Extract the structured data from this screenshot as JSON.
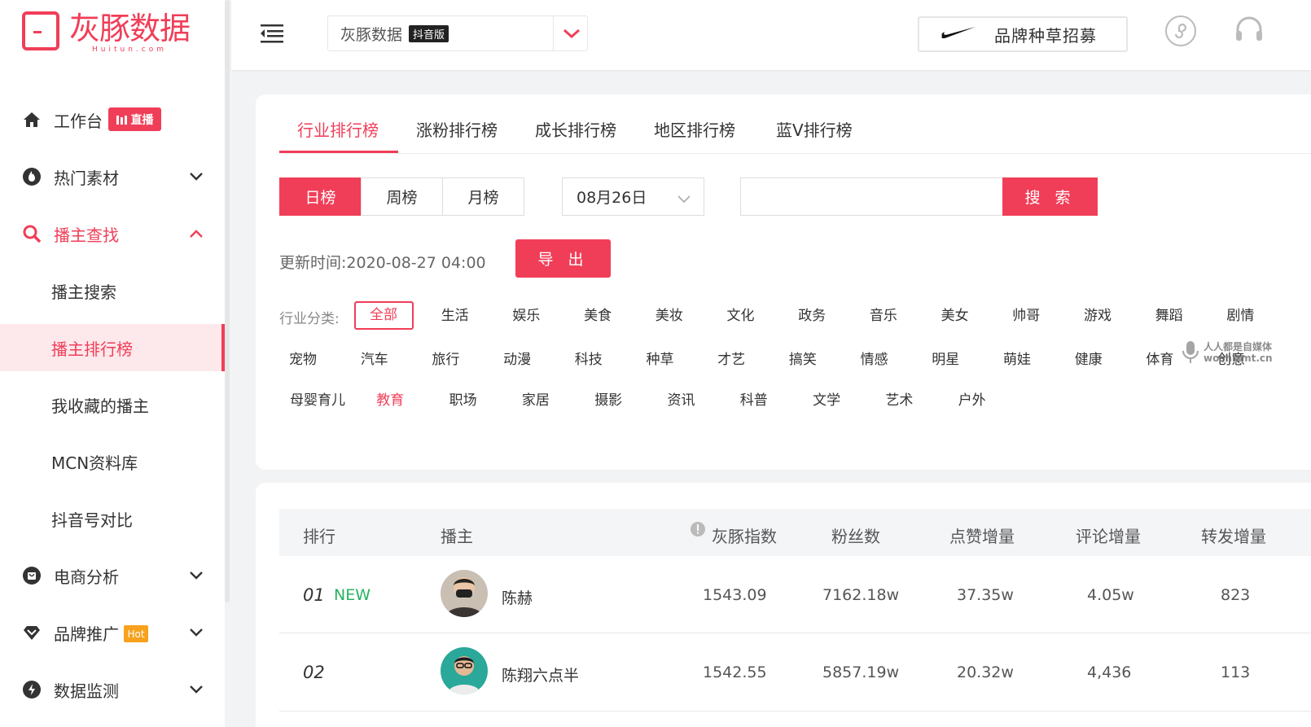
{
  "brand": {
    "name_cn": "灰豚数据",
    "name_en": "Huitun.com",
    "accent": "#f03e58"
  },
  "sidebar": {
    "workbench": {
      "label": "工作台",
      "badge": "直播"
    },
    "hot_material": {
      "label": "热门素材"
    },
    "anchor_find": {
      "label": "播主查找",
      "sub": [
        "播主搜索",
        "播主排行榜",
        "我收藏的播主",
        "MCN资料库",
        "抖音号对比"
      ]
    },
    "ecommerce": {
      "label": "电商分析"
    },
    "brand_promo": {
      "label": "品牌推广",
      "badge": "Hot"
    },
    "data_monitor": {
      "label": "数据监测"
    }
  },
  "topbar": {
    "app_name": "灰豚数据",
    "app_tag": "抖音版",
    "brand_button": "品牌种草招募"
  },
  "tabs": [
    "行业排行榜",
    "涨粉排行榜",
    "成长排行榜",
    "地区排行榜",
    "蓝V排行榜"
  ],
  "periods": [
    "日榜",
    "周榜",
    "月榜"
  ],
  "date": "08月26日",
  "search": {
    "button": "搜 索",
    "placeholder": ""
  },
  "update": {
    "label": "更新时间:",
    "value": "2020-08-27 04:00"
  },
  "export_button": "导 出",
  "category": {
    "label": "行业分类:",
    "row1": [
      "全部",
      "生活",
      "娱乐",
      "美食",
      "美妆",
      "文化",
      "政务",
      "音乐",
      "美女",
      "帅哥",
      "游戏",
      "舞蹈",
      "剧情"
    ],
    "row2": [
      "宠物",
      "汽车",
      "旅行",
      "动漫",
      "科技",
      "种草",
      "才艺",
      "搞笑",
      "情感",
      "明星",
      "萌娃",
      "健康",
      "体育",
      "创意"
    ],
    "row3": [
      "母婴育儿",
      "教育",
      "职场",
      "家居",
      "摄影",
      "资讯",
      "科普",
      "文学",
      "艺术",
      "户外"
    ]
  },
  "table": {
    "headers": [
      "排行",
      "播主",
      "灰豚指数",
      "粉丝数",
      "点赞增量",
      "评论增量",
      "转发增量"
    ],
    "rows": [
      {
        "rank": "01",
        "tag": "NEW",
        "name": "陈赫",
        "index": "1543.09",
        "fans": "7162.18w",
        "likes": "37.35w",
        "comments": "4.05w",
        "shares": "823"
      },
      {
        "rank": "02",
        "tag": "",
        "name": "陈翔六点半",
        "index": "1542.55",
        "fans": "5857.19w",
        "likes": "20.32w",
        "comments": "4,436",
        "shares": "113"
      }
    ]
  },
  "watermark": {
    "line1": "人人都是自媒体",
    "line2": "woshizmt.cn"
  }
}
